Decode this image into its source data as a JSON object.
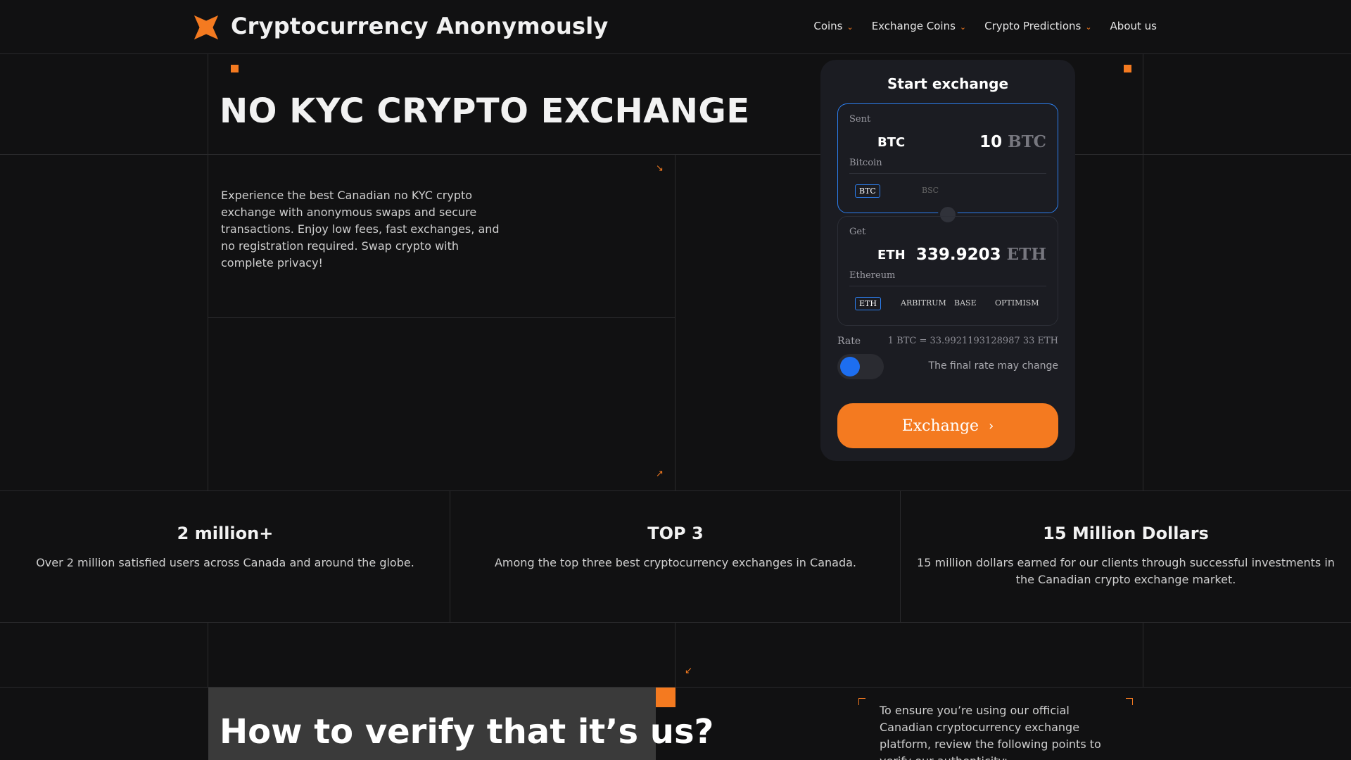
{
  "header": {
    "brand": "Cryptocurrency Anonymously",
    "nav": [
      {
        "label": "Coins",
        "has_dropdown": true
      },
      {
        "label": "Exchange Coins",
        "has_dropdown": true
      },
      {
        "label": "Crypto Predictions",
        "has_dropdown": true
      },
      {
        "label": "About us",
        "has_dropdown": false
      }
    ]
  },
  "hero": {
    "title": "NO KYC CRYPTO EXCHANGE",
    "description": "Experience the best Canadian no KYC crypto exchange with anonymous swaps and secure transactions. Enjoy low fees, fast exchanges, and no registration required. Swap crypto with complete privacy!"
  },
  "exchange": {
    "title": "Start exchange",
    "sent": {
      "label": "Sent",
      "symbol": "BTC",
      "name": "Bitcoin",
      "amount": "10",
      "unit": "BTC",
      "networks": [
        "BTC",
        "BSC"
      ]
    },
    "get": {
      "label": "Get",
      "symbol": "ETH",
      "name": "Ethereum",
      "amount": "339.9203",
      "unit": "ETH",
      "networks": [
        "ETH",
        "ARBITRUM",
        "BASE",
        "OPTIMISM"
      ]
    },
    "rate_label": "Rate",
    "rate_value": "1 BTC = 33.9921193128987 33 ETH",
    "rate_note": "The final rate may change",
    "button": "Exchange"
  },
  "stats": [
    {
      "title": "2 million+",
      "text": "Over 2 million satisfied users across Canada and around the globe."
    },
    {
      "title": "TOP 3",
      "text": "Among the top three best cryptocurrency exchanges in Canada."
    },
    {
      "title": "15 Million Dollars",
      "text": "15 million dollars earned for our clients through successful investments in the Canadian crypto exchange market."
    }
  ],
  "verify": {
    "title": "How to verify that it’s us?",
    "text": "To ensure you’re using our official Canadian cryptocurrency exchange platform, review the following points to verify our authenticity:"
  },
  "colors": {
    "accent": "#f47a20",
    "blue": "#2c7ff0",
    "background": "#111112",
    "card": "#1b1c22"
  }
}
